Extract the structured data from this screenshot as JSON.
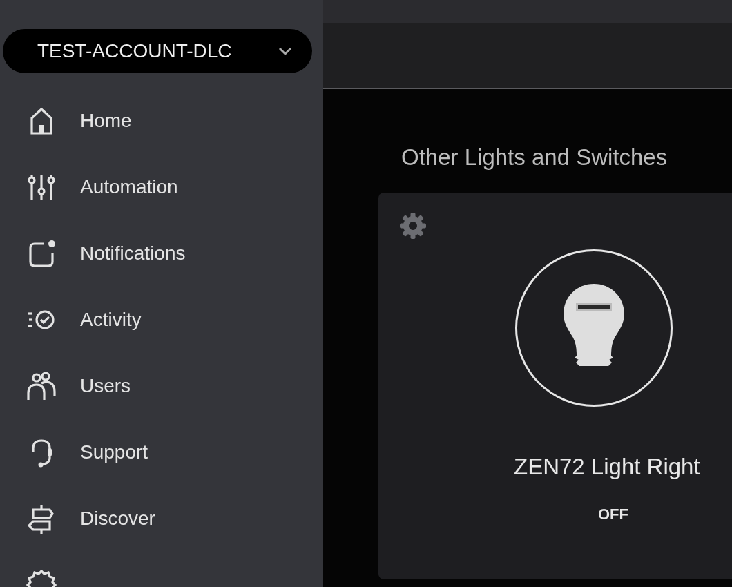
{
  "account": {
    "name": "TEST-ACCOUNT-DLC"
  },
  "sidebar": {
    "items": [
      {
        "kind": "home",
        "label": "Home"
      },
      {
        "kind": "sliders",
        "label": "Automation"
      },
      {
        "kind": "notification",
        "label": "Notifications"
      },
      {
        "kind": "activity",
        "label": "Activity"
      },
      {
        "kind": "users",
        "label": "Users"
      },
      {
        "kind": "headset",
        "label": "Support"
      },
      {
        "kind": "signpost",
        "label": "Discover"
      },
      {
        "kind": "gear"
      }
    ]
  },
  "section": {
    "title": "Other Lights and Switches"
  },
  "device": {
    "name": "ZEN72 Light Right",
    "status": "OFF",
    "on": false
  }
}
